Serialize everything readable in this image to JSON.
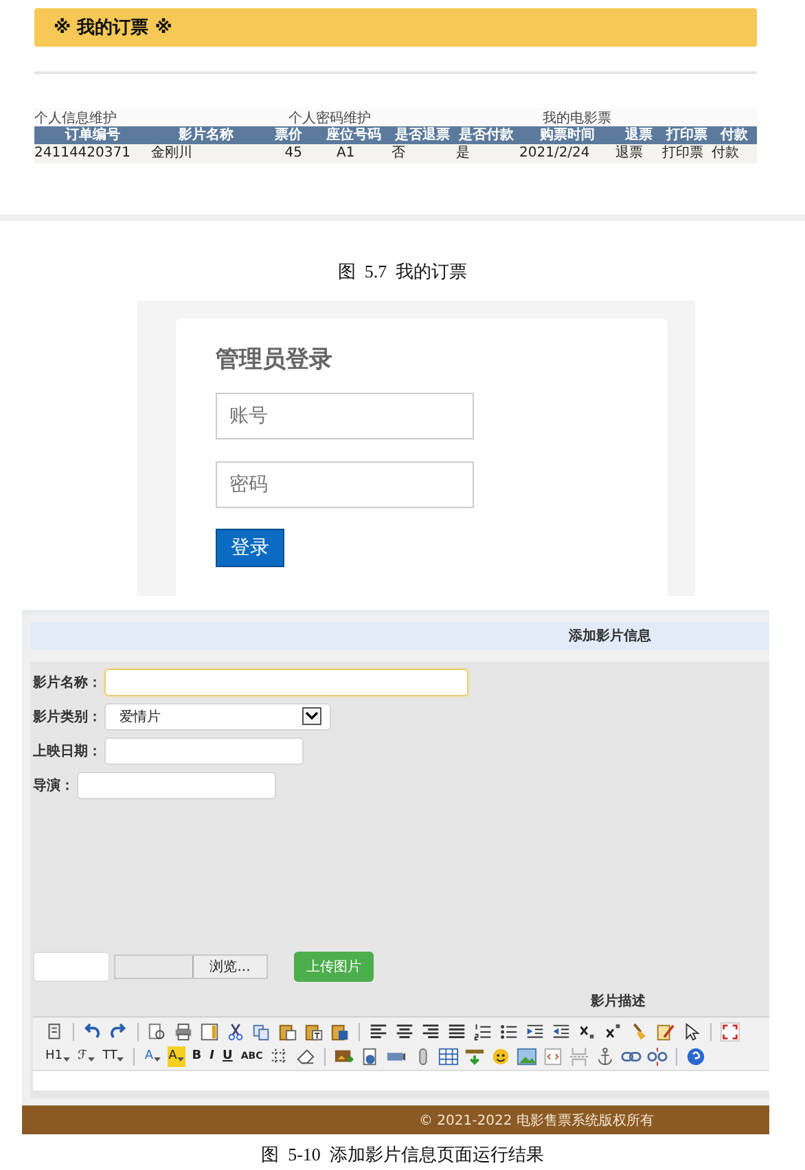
{
  "orders_page": {
    "title": "※ 我的订票 ※",
    "nav_links": [
      "个人信息维护",
      "个人密码维护",
      "我的电影票"
    ],
    "table": {
      "columns": [
        "订单编号",
        "影片名称",
        "票价",
        "座位号码",
        "是否退票",
        "是否付款",
        "购票时间",
        "退票",
        "打印票",
        "付款"
      ],
      "rows": [
        {
          "cells": [
            "24114420371",
            "金刚川",
            "45",
            "A1",
            "否",
            "是",
            "2021/2/24",
            "退票",
            "打印票",
            "付款"
          ]
        }
      ]
    }
  },
  "caption_1": "图  5.7  我的订票",
  "login": {
    "title": "管理员登录",
    "fields": [
      {
        "placeholder": "账号"
      },
      {
        "placeholder": "密码"
      }
    ],
    "button": "登录"
  },
  "movie_form": {
    "header": "添加影片信息",
    "fields": [
      {
        "kind": "text",
        "label": "影片名称：",
        "focused": true
      },
      {
        "kind": "select",
        "label": "影片类别：",
        "value": "爱情片"
      },
      {
        "kind": "text",
        "label": "上映日期：",
        "focused": false
      },
      {
        "kind": "text",
        "label": "导演：",
        "focused": false
      }
    ],
    "browse_button": "浏览...",
    "upload_button": "上传图片",
    "description_label": "影片描述",
    "toolbar_text_buttons": [
      {
        "kind": "heading",
        "label": "H1",
        "dropdown": true
      },
      {
        "kind": "font",
        "label": "ℱ",
        "dropdown": true
      },
      {
        "kind": "size",
        "label": "TT",
        "dropdown": true
      },
      {
        "kind": "font-color",
        "label": "A",
        "dropdown": true
      },
      {
        "kind": "highlight",
        "label": "A",
        "dropdown": true
      },
      {
        "kind": "bold",
        "label": "B",
        "dropdown": false
      },
      {
        "kind": "italic",
        "label": "I",
        "dropdown": false
      },
      {
        "kind": "underline",
        "label": "U",
        "dropdown": false
      },
      {
        "kind": "strike",
        "label": "ABC",
        "dropdown": false
      }
    ]
  },
  "footer": "© 2021-2022 电影售票系统版权所有",
  "caption_2": "图  5-10  添加影片信息页面运行结果"
}
